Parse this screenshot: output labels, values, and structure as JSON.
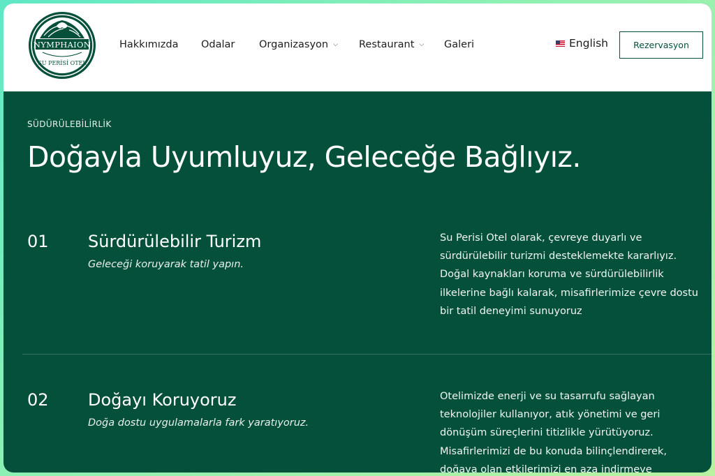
{
  "brand": {
    "name": "NYMPHAION",
    "tagline": "SU PERİSİ OTEL",
    "color": "#05503a"
  },
  "nav": {
    "items": [
      {
        "label": "Hakkımızda",
        "has_dropdown": false
      },
      {
        "label": "Odalar",
        "has_dropdown": false
      },
      {
        "label": "Organizasyon",
        "has_dropdown": true
      },
      {
        "label": "Restaurant",
        "has_dropdown": true
      },
      {
        "label": "Galeri",
        "has_dropdown": false
      }
    ],
    "language": {
      "label": "English",
      "icon": "us-flag-icon"
    },
    "cta_label": "Rezervasyon"
  },
  "hero": {
    "eyebrow": "SÜDÜRÜLEBİLİRLİK",
    "title": "Doğayla Uyumluyuz, Geleceğe Bağlıyız."
  },
  "rows": [
    {
      "number": "01",
      "title": "Sürdürülebilir Turizm",
      "subtitle": "Geleceği koruyarak tatil yapın.",
      "description": "Su Perisi Otel olarak, çevreye duyarlı ve sürdürülebilir turizmi desteklemekte kararlıyız. Doğal kaynakları koruma ve sürdürülebilirlik ilkelerine bağlı kalarak, misafirlerimize çevre dostu bir tatil deneyimi sunuyoruz"
    },
    {
      "number": "02",
      "title": "Doğayı Koruyoruz",
      "subtitle": "Doğa dostu uygulamalarla fark yaratıyoruz.",
      "description": "Otelimizde enerji ve su tasarrufu sağlayan teknolojiler kullanıyor, atık yönetimi ve geri dönüşüm süreçlerini titizlikle yürütüyoruz. Misafirlerimizi de bu konuda bilinçlendirerek, doğaya olan etkilerimizi en aza indirmeye"
    }
  ]
}
